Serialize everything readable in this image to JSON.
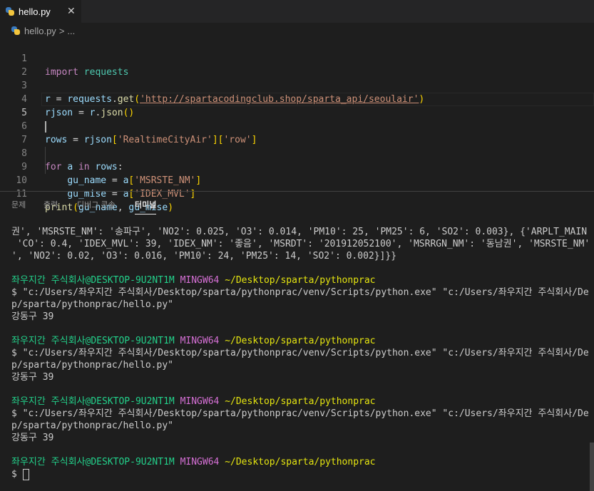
{
  "tab": {
    "filename": "hello.py",
    "close": "✕"
  },
  "breadcrumb": {
    "file": "hello.py",
    "sep": ">",
    "more": "..."
  },
  "editor": {
    "lines": [
      {
        "num": "1"
      },
      {
        "num": "2"
      },
      {
        "num": "3"
      },
      {
        "num": "4"
      },
      {
        "num": "5"
      },
      {
        "num": "6"
      },
      {
        "num": "7"
      },
      {
        "num": "8"
      },
      {
        "num": "9"
      },
      {
        "num": "10"
      },
      {
        "num": "11"
      }
    ],
    "tokens": {
      "import": "import",
      "requests": "requests",
      "r": "r",
      "eq": " = ",
      "requests2": "requests",
      "dot": ".",
      "get": "get",
      "url": "'http://spartacodingclub.shop/sparta_api/seoulair'",
      "rjson": "rjson",
      "r2": "r",
      "json": "json",
      "rows": "rows",
      "rjson2": "rjson",
      "key1": "'RealtimeCityAir'",
      "key2": "'row'",
      "for": "for",
      "a": "a",
      "in": "in",
      "rows2": "rows",
      "colon": ":",
      "gu_name": "gu_name",
      "a2": "a",
      "key3": "'MSRSTE_NM'",
      "gu_mise": "gu_mise",
      "a3": "a",
      "key4": "'IDEX_MVL'",
      "print": "print",
      "gu_name2": "gu_name",
      "comma": ", ",
      "gu_mise2": "gu_mise"
    }
  },
  "panel": {
    "tabs": [
      "문제",
      "출력",
      "디버그 콘솔",
      "터미널"
    ],
    "terminal": {
      "out1": "권', 'MSRSTE_NM': '송파구', 'NO2': 0.025, 'O3': 0.014, 'PM10': 25, 'PM25': 6, 'SO2': 0.003}, {'ARPLT_MAIN': 'PM25',",
      "out2": " 'CO': 0.4, 'IDEX_MVL': 39, 'IDEX_NM': '좋음', 'MSRDT': '201912052100', 'MSRRGN_NM': '동남권', 'MSRSTE_NM': '강동구",
      "out3": "', 'NO2': 0.02, 'O3': 0.016, 'PM10': 24, 'PM25': 14, 'SO2': 0.002}]}}",
      "user": "좌우지간 주식회사@DESKTOP-9U2NT1M",
      "shell": "MINGW64",
      "path": "~/Desktop/sparta/pythonprac",
      "cmd1": "$ \"c:/Users/좌우지간 주식회사/Desktop/sparta/pythonprac/venv/Scripts/python.exe\" \"c:/Users/좌우지간 주식회사/Deskto",
      "cmd2": "p/sparta/pythonprac/hello.py\"",
      "result": "강동구 39",
      "prompt": "$ "
    }
  }
}
